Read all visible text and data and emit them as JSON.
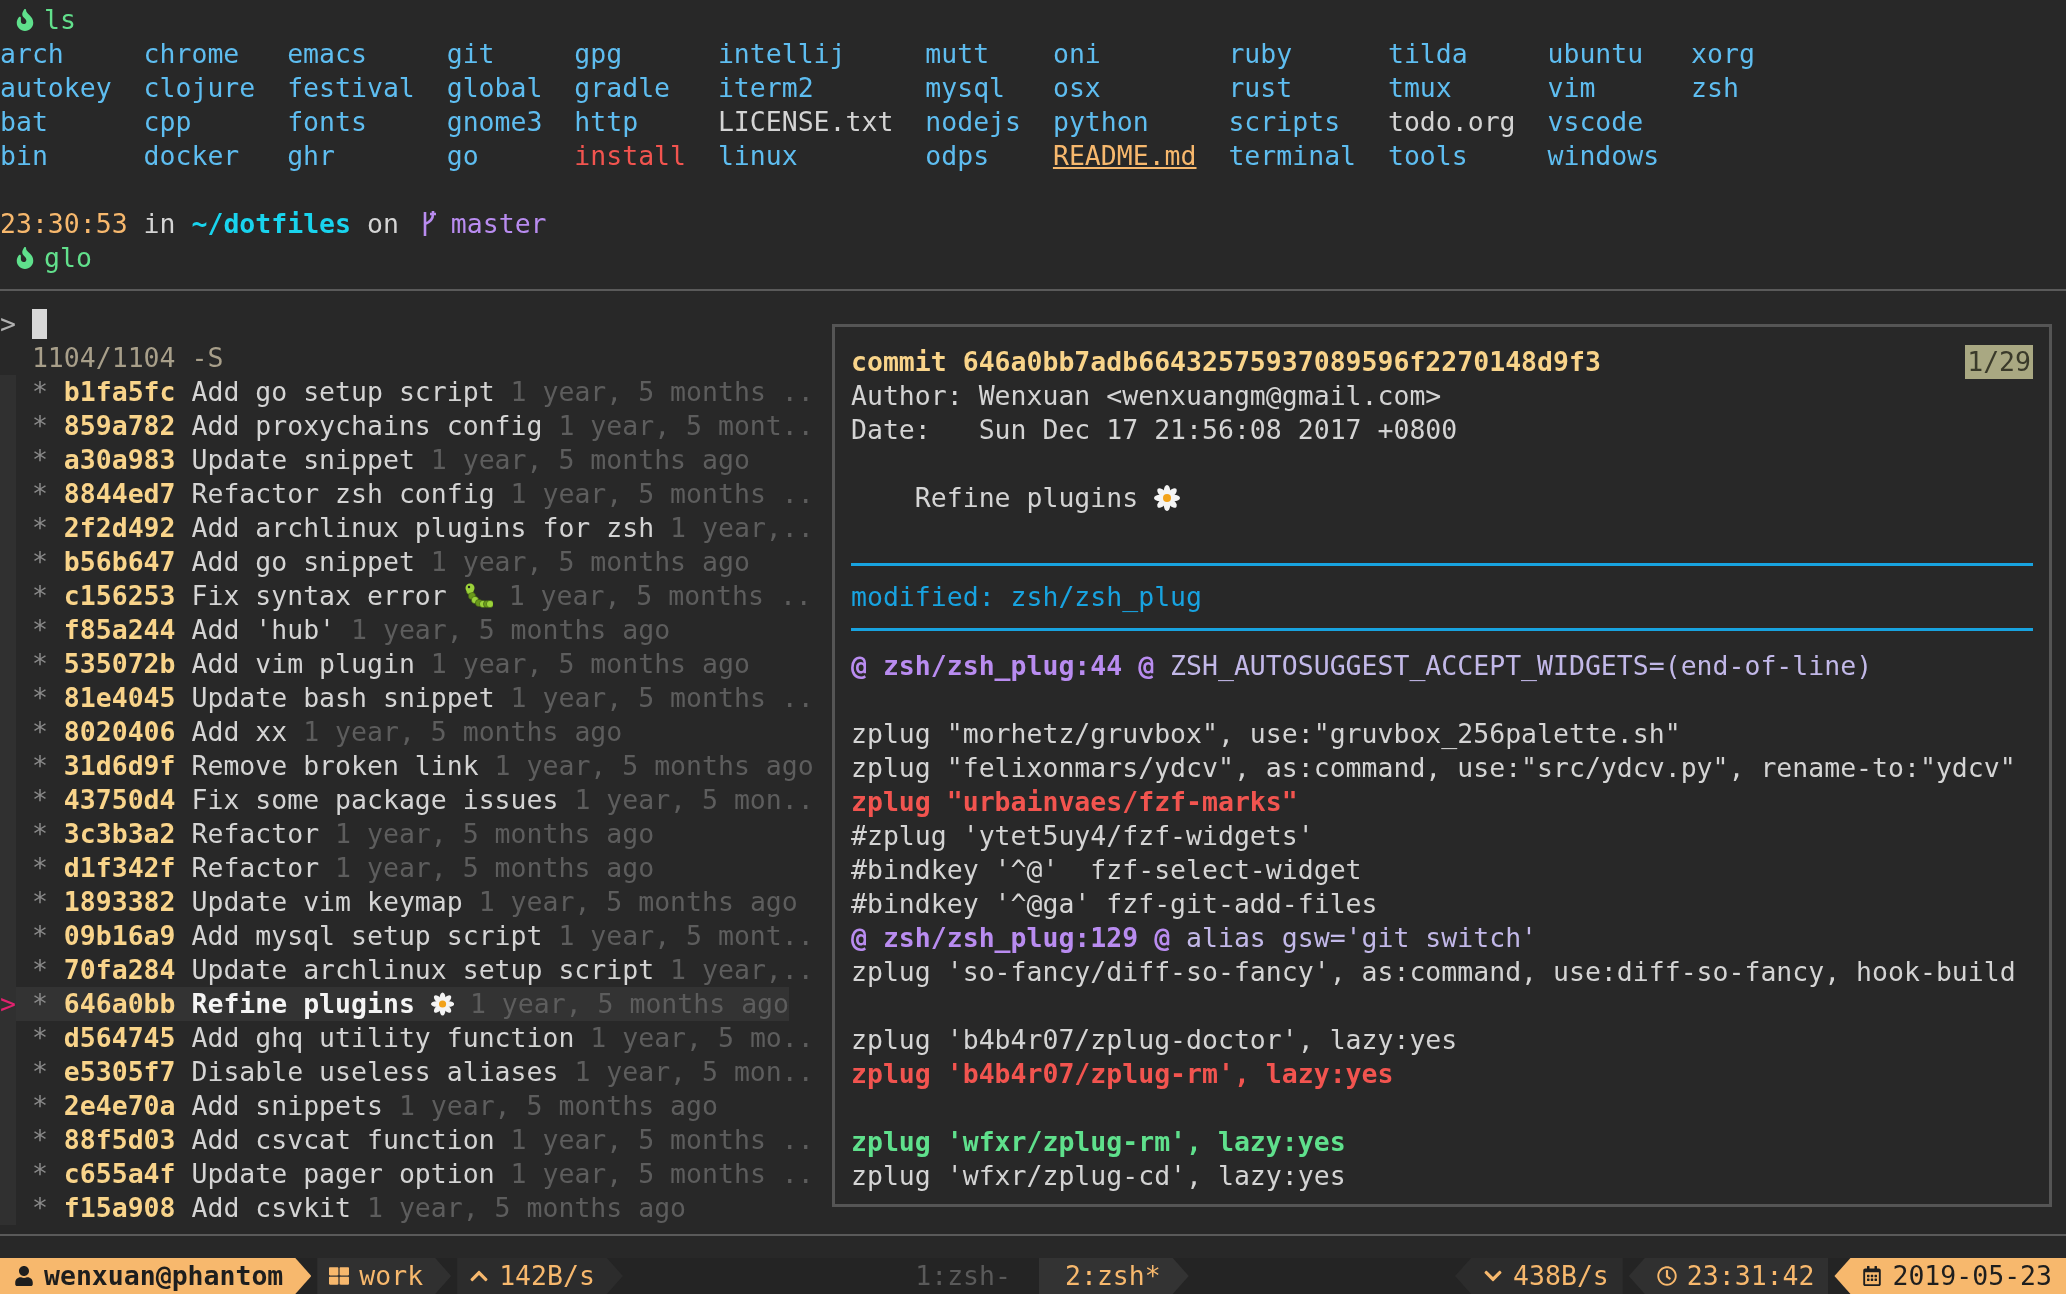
{
  "shell": {
    "first_command": "ls",
    "ls_rows": [
      [
        {
          "name": "arch",
          "kind": "dir"
        },
        {
          "name": "chrome",
          "kind": "dir"
        },
        {
          "name": "emacs",
          "kind": "dir"
        },
        {
          "name": "git",
          "kind": "dir"
        },
        {
          "name": "gpg",
          "kind": "dir"
        },
        {
          "name": "intellij",
          "kind": "dir"
        },
        {
          "name": "mutt",
          "kind": "dir"
        },
        {
          "name": "oni",
          "kind": "dir"
        },
        {
          "name": "ruby",
          "kind": "dir"
        },
        {
          "name": "tilda",
          "kind": "dir"
        },
        {
          "name": "ubuntu",
          "kind": "dir"
        },
        {
          "name": "xorg",
          "kind": "dir"
        }
      ],
      [
        {
          "name": "autokey",
          "kind": "dir"
        },
        {
          "name": "clojure",
          "kind": "dir"
        },
        {
          "name": "festival",
          "kind": "dir"
        },
        {
          "name": "global",
          "kind": "dir"
        },
        {
          "name": "gradle",
          "kind": "dir"
        },
        {
          "name": "iterm2",
          "kind": "dir"
        },
        {
          "name": "mysql",
          "kind": "dir"
        },
        {
          "name": "osx",
          "kind": "dir"
        },
        {
          "name": "rust",
          "kind": "dir"
        },
        {
          "name": "tmux",
          "kind": "dir"
        },
        {
          "name": "vim",
          "kind": "dir"
        },
        {
          "name": "zsh",
          "kind": "dir"
        }
      ],
      [
        {
          "name": "bat",
          "kind": "dir"
        },
        {
          "name": "cpp",
          "kind": "dir"
        },
        {
          "name": "fonts",
          "kind": "dir"
        },
        {
          "name": "gnome3",
          "kind": "dir"
        },
        {
          "name": "http",
          "kind": "dir"
        },
        {
          "name": "LICENSE.txt",
          "kind": "file"
        },
        {
          "name": "nodejs",
          "kind": "dir"
        },
        {
          "name": "python",
          "kind": "dir"
        },
        {
          "name": "scripts",
          "kind": "dir"
        },
        {
          "name": "todo.org",
          "kind": "file"
        },
        {
          "name": "vscode",
          "kind": "dir"
        }
      ],
      [
        {
          "name": "bin",
          "kind": "dir"
        },
        {
          "name": "docker",
          "kind": "dir"
        },
        {
          "name": "ghr",
          "kind": "dir"
        },
        {
          "name": "go",
          "kind": "dir"
        },
        {
          "name": "install",
          "kind": "exec"
        },
        {
          "name": "linux",
          "kind": "dir"
        },
        {
          "name": "odps",
          "kind": "dir"
        },
        {
          "name": "README.md",
          "kind": "readme"
        },
        {
          "name": "terminal",
          "kind": "dir"
        },
        {
          "name": "tools",
          "kind": "dir"
        },
        {
          "name": "windows",
          "kind": "dir"
        }
      ]
    ],
    "prompt": {
      "time": "23:30:53",
      "in": "in",
      "path": "~/dotfiles",
      "on": "on",
      "branch": "master"
    },
    "second_command": "glo"
  },
  "fzf": {
    "prompt": ">",
    "counter": "1104/1104 -S",
    "pointer": ">",
    "commits": [
      {
        "graph": "*",
        "hash": "b1fa5fc",
        "message": "Add go setup script",
        "age": "1 year, 5 months ..",
        "selected": false
      },
      {
        "graph": "*",
        "hash": "859a782",
        "message": "Add proxychains config",
        "age": "1 year, 5 mont..",
        "selected": false
      },
      {
        "graph": "*",
        "hash": "a30a983",
        "message": "Update snippet",
        "age": "1 year, 5 months ago",
        "selected": false
      },
      {
        "graph": "*",
        "hash": "8844ed7",
        "message": "Refactor zsh config",
        "age": "1 year, 5 months ..",
        "selected": false
      },
      {
        "graph": "*",
        "hash": "2f2d492",
        "message": "Add archlinux plugins for zsh",
        "age": "1 year,..",
        "selected": false
      },
      {
        "graph": "*",
        "hash": "b56b647",
        "message": "Add go snippet",
        "age": "1 year, 5 months ago",
        "selected": false
      },
      {
        "graph": "*",
        "hash": "c156253",
        "message": "Fix syntax error",
        "kind": "caterpillar",
        "age": "1 year, 5 months ..",
        "selected": false
      },
      {
        "graph": "*",
        "hash": "f85a244",
        "message": "Add 'hub'",
        "age": "1 year, 5 months ago",
        "selected": false
      },
      {
        "graph": "*",
        "hash": "535072b",
        "message": "Add vim plugin",
        "age": "1 year, 5 months ago",
        "selected": false
      },
      {
        "graph": "*",
        "hash": "81e4045",
        "message": "Update bash snippet",
        "age": "1 year, 5 months ..",
        "selected": false
      },
      {
        "graph": "*",
        "hash": "8020406",
        "message": "Add xx",
        "age": "1 year, 5 months ago",
        "selected": false
      },
      {
        "graph": "*",
        "hash": "31d6d9f",
        "message": "Remove broken link",
        "age": "1 year, 5 months ago",
        "selected": false
      },
      {
        "graph": "*",
        "hash": "43750d4",
        "message": "Fix some package issues",
        "age": "1 year, 5 mon..",
        "selected": false
      },
      {
        "graph": "*",
        "hash": "3c3b3a2",
        "message": "Refactor",
        "age": "1 year, 5 months ago",
        "selected": false
      },
      {
        "graph": "*",
        "hash": "d1f342f",
        "message": "Refactor",
        "age": "1 year, 5 months ago",
        "selected": false
      },
      {
        "graph": "*",
        "hash": "1893382",
        "message": "Update vim keymap",
        "age": "1 year, 5 months ago",
        "selected": false
      },
      {
        "graph": "*",
        "hash": "09b16a9",
        "message": "Add mysql setup script",
        "age": "1 year, 5 mont..",
        "selected": false
      },
      {
        "graph": "*",
        "hash": "70fa284",
        "message": "Update archlinux setup script",
        "age": "1 year,..",
        "selected": false
      },
      {
        "graph": "*",
        "hash": "646a0bb",
        "message": "Refine plugins",
        "kind": "flower",
        "age": "1 year, 5 months ago",
        "selected": true
      },
      {
        "graph": "*",
        "hash": "d564745",
        "message": "Add ghq utility function",
        "age": "1 year, 5 mo..",
        "selected": false
      },
      {
        "graph": "*",
        "hash": "e5305f7",
        "message": "Disable useless aliases",
        "age": "1 year, 5 mon..",
        "selected": false
      },
      {
        "graph": "*",
        "hash": "2e4e70a",
        "message": "Add snippets",
        "age": "1 year, 5 months ago",
        "selected": false
      },
      {
        "graph": "*",
        "hash": "88f5d03",
        "message": "Add csvcat function",
        "age": "1 year, 5 months ..",
        "selected": false
      },
      {
        "graph": "*",
        "hash": "c655a4f",
        "message": "Update pager option",
        "age": "1 year, 5 months ..",
        "selected": false
      },
      {
        "graph": "*",
        "hash": "f15a908",
        "message": "Add csvkit",
        "age": "1 year, 5 months ago",
        "selected": false
      }
    ]
  },
  "preview": {
    "commit": "commit 646a0bb7adb66432575937089596f2270148d9f3",
    "page": "1/29",
    "author": "Author: Wenxuan <wenxuangm@gmail.com>",
    "date": "Date:   Sun Dec 17 21:56:08 2017 +0800",
    "message": {
      "text": "Refine plugins",
      "kind": "flower"
    },
    "modified": "modified: zsh/zsh_plug",
    "diff_lines": [
      {
        "kind": "hunk",
        "location": "@ zsh/zsh_plug:44 @",
        "text": " ZSH_AUTOSUGGEST_ACCEPT_WIDGETS=(end-of-line)"
      },
      {
        "kind": "blank"
      },
      {
        "kind": "context",
        "text": "zplug \"morhetz/gruvbox\", use:\"gruvbox_256palette.sh\""
      },
      {
        "kind": "context",
        "text": "zplug \"felixonmars/ydcv\", as:command, use:\"src/ydcv.py\", rename-to:\"ydcv\""
      },
      {
        "kind": "removed",
        "text": "zplug \"urbainvaes/fzf-marks\""
      },
      {
        "kind": "context",
        "text": "#zplug 'ytet5uy4/fzf-widgets'"
      },
      {
        "kind": "context",
        "text": "#bindkey '^@'  fzf-select-widget"
      },
      {
        "kind": "context",
        "text": "#bindkey '^@ga' fzf-git-add-files"
      },
      {
        "kind": "hunk",
        "location": "@ zsh/zsh_plug:129 @",
        "text": " alias gsw='git switch'"
      },
      {
        "kind": "context",
        "text": "zplug 'so-fancy/diff-so-fancy', as:command, use:diff-so-fancy, hook-build"
      },
      {
        "kind": "blank"
      },
      {
        "kind": "context",
        "text": "zplug 'b4b4r07/zplug-doctor', lazy:yes"
      },
      {
        "kind": "removed",
        "text": "zplug 'b4b4r07/zplug-rm', lazy:yes"
      },
      {
        "kind": "blank"
      },
      {
        "kind": "added",
        "text": "zplug 'wfxr/zplug-rm', lazy:yes"
      },
      {
        "kind": "context",
        "text": "zplug 'wfxr/zplug-cd', lazy:yes"
      }
    ]
  },
  "status_bar": {
    "user": "wenxuan@phantom",
    "session": "work",
    "upload": "142B/s",
    "windows": [
      {
        "label": "1:zsh-",
        "selected": false
      },
      {
        "label": "2:zsh*",
        "selected": true
      }
    ],
    "download": "438B/s",
    "time": "23:31:42",
    "date": "2019-05-23"
  }
}
